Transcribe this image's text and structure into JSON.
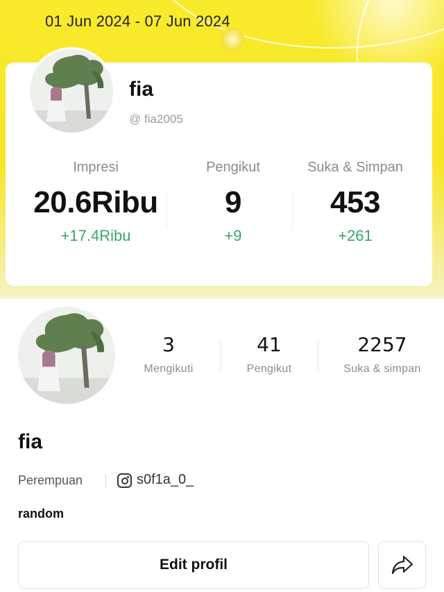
{
  "header": {
    "date_range": "01 Jun 2024 - 07 Jun 2024"
  },
  "stats_card": {
    "name": "fia",
    "handle": "@ fia2005",
    "metrics": [
      {
        "label": "Impresi",
        "value": "20.6Ribu",
        "delta": "+17.4Ribu"
      },
      {
        "label": "Pengikut",
        "value": "9",
        "delta": "+9"
      },
      {
        "label": "Suka & Simpan",
        "value": "453",
        "delta": "+261"
      }
    ]
  },
  "profile": {
    "stats": [
      {
        "value": "3",
        "label": "Mengikuti"
      },
      {
        "value": "41",
        "label": "Pengikut"
      },
      {
        "value": "2257",
        "label": "Suka & simpan"
      }
    ],
    "name": "fia",
    "gender": "Perempuan",
    "instagram": "s0f1a_0_",
    "bio": "random",
    "edit_label": "Edit profil"
  },
  "icons": {
    "instagram": "instagram-icon",
    "share": "share-icon"
  },
  "colors": {
    "accent_yellow": "#f9ea2c",
    "delta_green": "#3aa56b"
  }
}
